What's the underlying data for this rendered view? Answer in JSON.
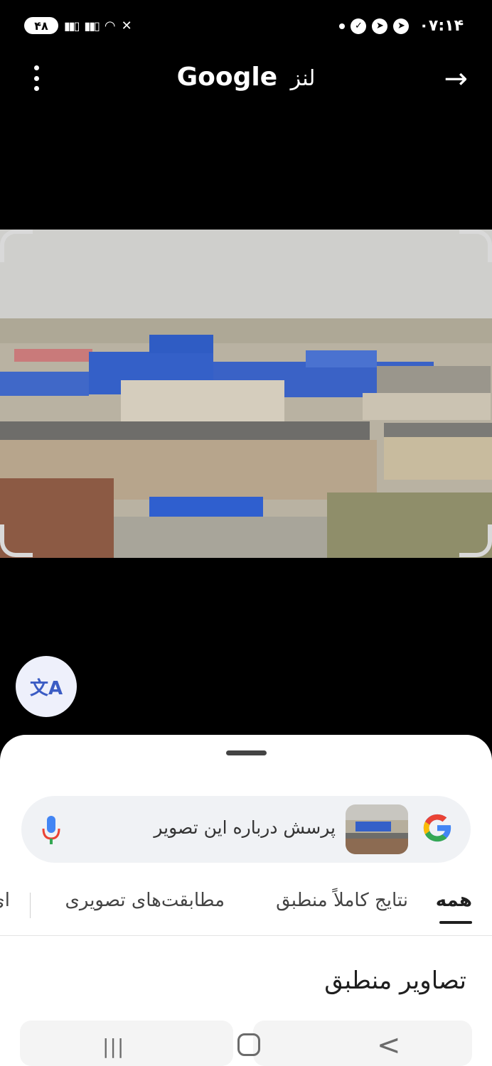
{
  "status": {
    "battery": "۴۸",
    "time": "۰۷:۱۴"
  },
  "topbar": {
    "title": "Google",
    "title_suffix": "لنز",
    "menu_icon": "more-vert-icon",
    "forward_icon": "arrow-right-icon"
  },
  "translate": {
    "icon": "translate-icon",
    "label": "文A"
  },
  "search": {
    "query": "پرسش درباره این تصویر",
    "mic_icon": "mic-icon",
    "logo": "google-g-logo"
  },
  "tabs": [
    {
      "label": "همه",
      "active": true
    },
    {
      "label": "نتایج کاملاً منطبق",
      "active": false
    },
    {
      "label": "مطابقت‌های تصویری",
      "active": false
    },
    {
      "label": "ای",
      "active": false
    }
  ],
  "results": {
    "section_title": "تصاویر منطبق"
  },
  "navbar": {
    "recents": "|||",
    "back": "<"
  },
  "colors": {
    "accent_blue": "#3b5cc4",
    "sheet_bg": "#ffffff",
    "search_bg": "#f0f2f5"
  }
}
